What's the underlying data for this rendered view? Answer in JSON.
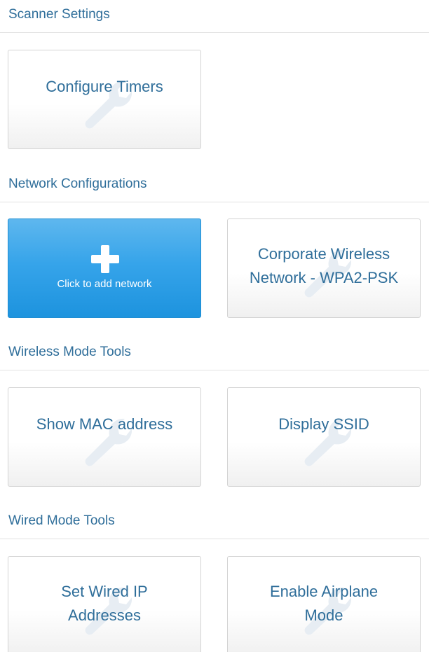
{
  "sections": [
    {
      "title": "Scanner Settings",
      "tiles": [
        {
          "label": "Configure Timers"
        }
      ]
    },
    {
      "title": "Network Configurations",
      "add_tile": {
        "label": "Click to add network"
      },
      "tiles": [
        {
          "label": "Corporate Wireless Network - WPA2-PSK"
        }
      ]
    },
    {
      "title": "Wireless Mode Tools",
      "tiles": [
        {
          "label": "Show MAC address"
        },
        {
          "label": "Display SSID"
        }
      ]
    },
    {
      "title": "Wired Mode Tools",
      "tiles": [
        {
          "label": "Set Wired IP Addresses"
        },
        {
          "label": "Enable Airplane Mode"
        }
      ]
    }
  ],
  "icons": {
    "tile_watermark": "wrench-icon",
    "add": "plus-icon"
  },
  "colors": {
    "section_title": "#2f6e9a",
    "tile_text": "#2f6e9a",
    "add_tile_top": "#5eb7ee",
    "add_tile_bottom": "#1d93de"
  }
}
